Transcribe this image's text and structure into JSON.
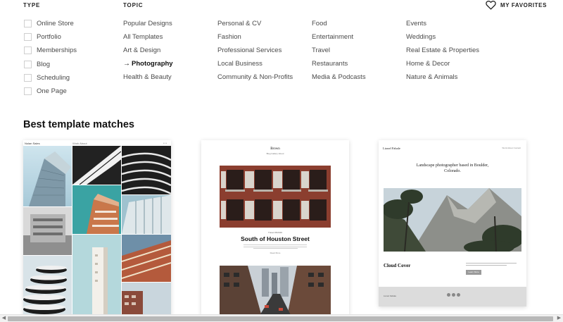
{
  "filters": {
    "type_heading": "TYPE",
    "topic_heading": "TOPIC",
    "type_items": [
      "Online Store",
      "Portfolio",
      "Memberships",
      "Blog",
      "Scheduling",
      "One Page"
    ],
    "topic_columns": [
      [
        "Popular Designs",
        "All Templates",
        "Art & Design",
        "Photography",
        "Health & Beauty"
      ],
      [
        "Personal & CV",
        "Fashion",
        "Professional Services",
        "Local Business",
        "Community & Non-Profits"
      ],
      [
        "Food",
        "Entertainment",
        "Travel",
        "Restaurants",
        "Media & Podcasts"
      ],
      [
        "Events",
        "Weddings",
        "Real Estate & Properties",
        "Home & Decor",
        "Nature & Animals"
      ]
    ],
    "active_topic": "Photography"
  },
  "favorites": {
    "label": "MY FAVORITES",
    "icon": "heart-outline-icon"
  },
  "section": {
    "title": "Best template matches"
  },
  "templates": [
    {
      "brand": "Nolan Sales",
      "links": "Work  About",
      "dots": "• • •"
    },
    {
      "brand": "Brown",
      "links": "Blog    Gallery    About",
      "category": "Travel   05/2019",
      "headline": "South of Houston Street",
      "read_more": "Read More"
    },
    {
      "brand": "Lionel Fabale",
      "links": "Work   About   Contact",
      "tagline": "Landscape photographer based in Boulder, Colorado.",
      "subhead": "Cloud Cover",
      "button": "Learn More",
      "footer_brand": "Lionel Fabale"
    }
  ],
  "scrollbar": {
    "left_arrow": "◀",
    "right_arrow": "▶"
  },
  "colors": {
    "accent_text": "#111111",
    "muted_text": "#4a4a4a",
    "checkbox_border": "#cfcfcf"
  }
}
